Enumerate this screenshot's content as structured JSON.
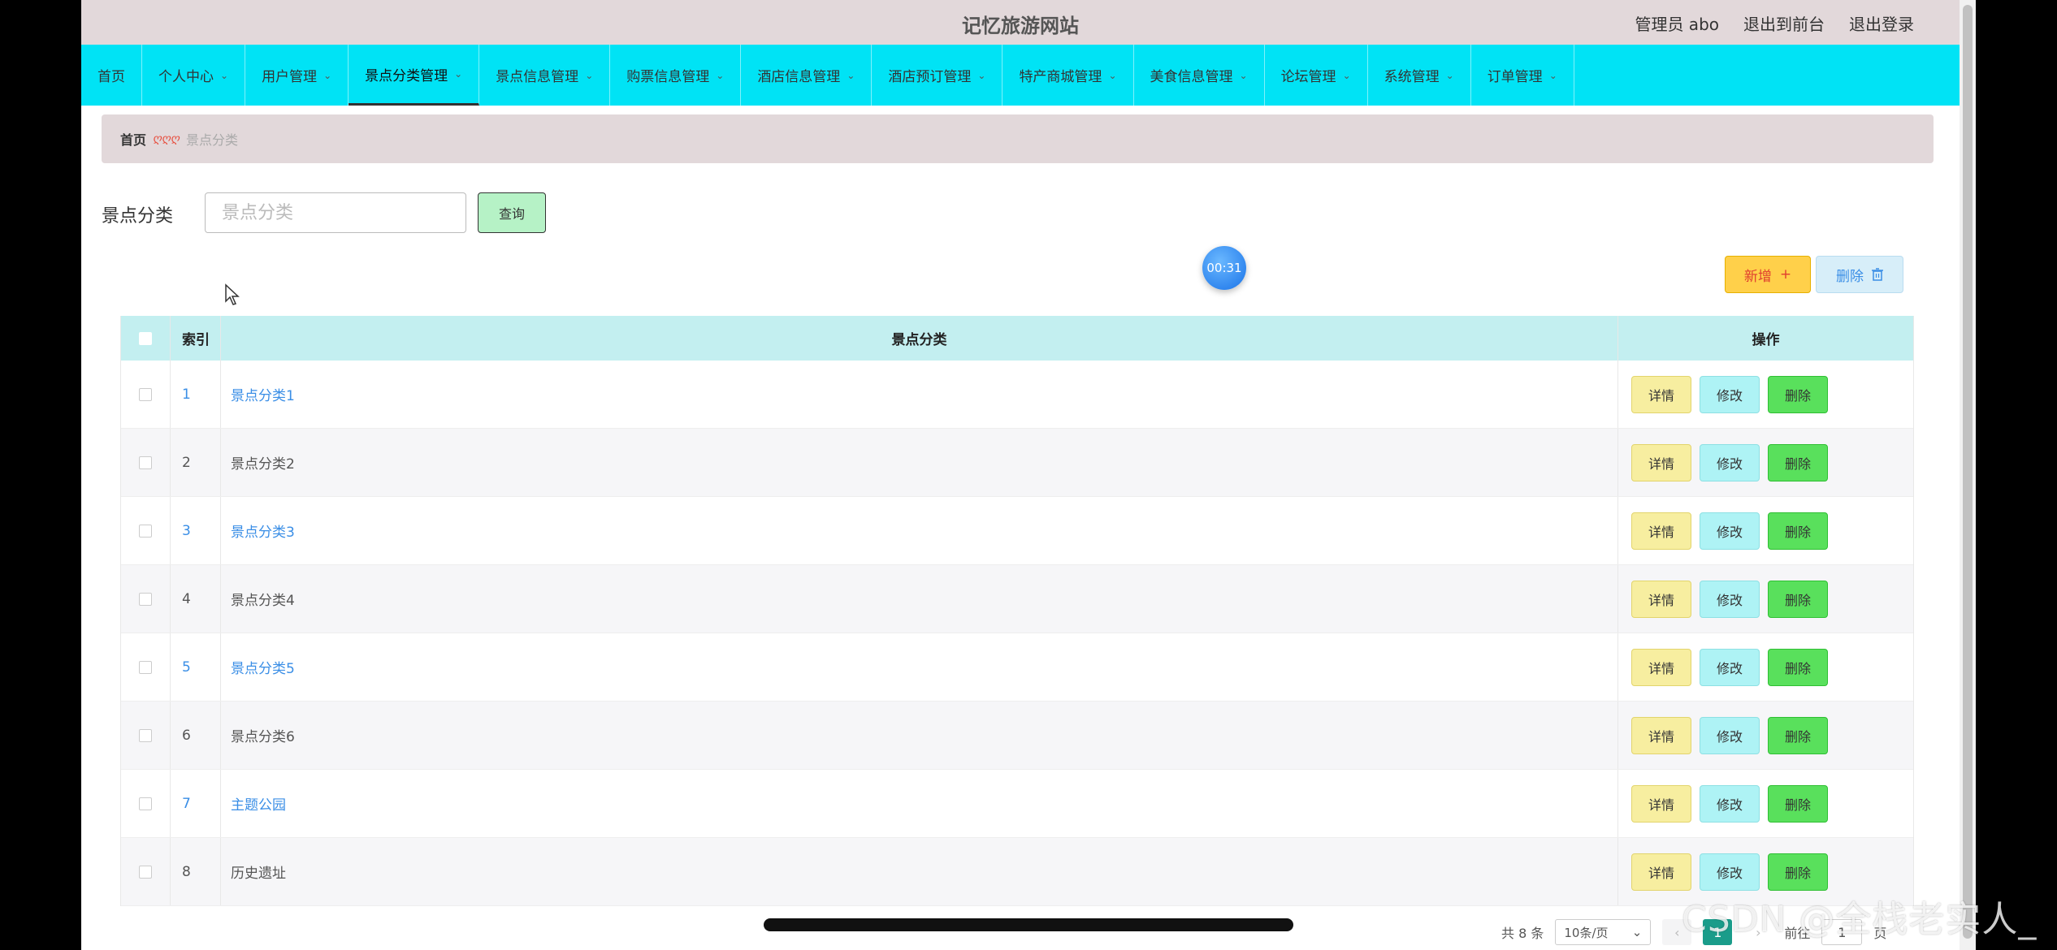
{
  "header": {
    "title": "记忆旅游网站",
    "admin_label": "管理员 abo",
    "front_label": "退出到前台",
    "logout_label": "退出登录"
  },
  "nav": {
    "items": [
      {
        "label": "首页",
        "dropdown": false
      },
      {
        "label": "个人中心",
        "dropdown": true
      },
      {
        "label": "用户管理",
        "dropdown": true
      },
      {
        "label": "景点分类管理",
        "dropdown": true,
        "active": true
      },
      {
        "label": "景点信息管理",
        "dropdown": true
      },
      {
        "label": "购票信息管理",
        "dropdown": true
      },
      {
        "label": "酒店信息管理",
        "dropdown": true
      },
      {
        "label": "酒店预订管理",
        "dropdown": true
      },
      {
        "label": "特产商城管理",
        "dropdown": true
      },
      {
        "label": "美食信息管理",
        "dropdown": true
      },
      {
        "label": "论坛管理",
        "dropdown": true
      },
      {
        "label": "系统管理",
        "dropdown": true
      },
      {
        "label": "订单管理",
        "dropdown": true
      }
    ]
  },
  "breadcrumb": {
    "home": "首页",
    "separator": "ღღღ",
    "current": "景点分类"
  },
  "search": {
    "label": "景点分类",
    "placeholder": "景点分类",
    "button": "查询"
  },
  "timer": "00:31",
  "actions": {
    "add": "新增",
    "delete": "删除"
  },
  "table": {
    "headers": {
      "index": "索引",
      "name": "景点分类",
      "ops": "操作"
    },
    "rows": [
      {
        "index": "1",
        "name": "景点分类1"
      },
      {
        "index": "2",
        "name": "景点分类2"
      },
      {
        "index": "3",
        "name": "景点分类3"
      },
      {
        "index": "4",
        "name": "景点分类4"
      },
      {
        "index": "5",
        "name": "景点分类5"
      },
      {
        "index": "6",
        "name": "景点分类6"
      },
      {
        "index": "7",
        "name": "主题公园"
      },
      {
        "index": "8",
        "name": "历史遗址"
      }
    ],
    "op_labels": {
      "detail": "详情",
      "edit": "修改",
      "delete": "删除"
    }
  },
  "pagination": {
    "total": "共 8 条",
    "page_size": "10条/页",
    "current_page": "1",
    "goto_prefix": "前往",
    "goto_value": "1",
    "goto_suffix": "页"
  },
  "watermark": "CSDN @全栈老实人_",
  "colors": {
    "header_bg": "#e2d8da",
    "nav_bg": "#00e3f5",
    "table_header_bg": "#c3eff0",
    "detail_btn": "#f7eea0",
    "edit_btn": "#aef3f5",
    "delete_btn": "#59e05c",
    "add_btn": "#ffd04a",
    "link": "#3a8ee6"
  }
}
